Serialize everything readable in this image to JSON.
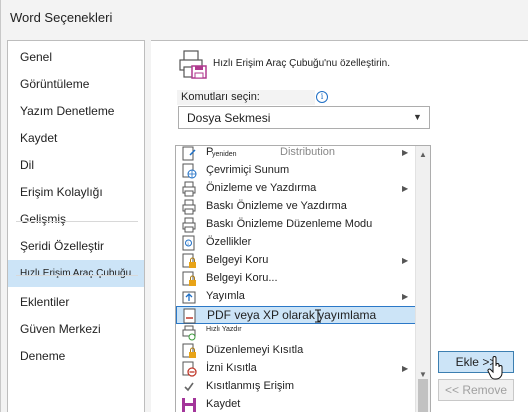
{
  "window": {
    "title": "Word Seçenekleri"
  },
  "sidebar": {
    "items": [
      {
        "label": "Genel"
      },
      {
        "label": "Görüntüleme"
      },
      {
        "label": "Yazım Denetleme"
      },
      {
        "label": "Kaydet"
      },
      {
        "label": "Dil"
      },
      {
        "label": "Erişim Kolaylığı"
      },
      {
        "label": "Gelişmiş"
      },
      {
        "label": "Şeridi Özelleştir"
      },
      {
        "label": "Hızlı Erişim Araç Çubuğu",
        "selected": true
      },
      {
        "label": "Eklentiler"
      },
      {
        "label": "Güven Merkezi"
      },
      {
        "label": "Deneme"
      }
    ]
  },
  "main": {
    "heading": "Hızlı Erişim Araç Çubuğu'nu özelleştirin.",
    "commands_label": "Komutları seçin:",
    "commands_dropdown": {
      "value": "Dosya Sekmesi"
    },
    "list": [
      {
        "label": "P",
        "small": "yeniden",
        "extra": "Distribution",
        "icon": "redistribute-icon",
        "submenu": true
      },
      {
        "label": "Çevrimiçi Sunum",
        "icon": "online-presentation-icon",
        "submenu": false
      },
      {
        "label": "Önizleme ve Yazdırma",
        "icon": "print-preview-icon",
        "submenu": true
      },
      {
        "label": "Baskı Önizleme ve Yazdırma",
        "icon": "print-preview-icon",
        "submenu": false
      },
      {
        "label": "Baskı Önizleme Düzenleme Modu",
        "icon": "print-preview-edit-icon",
        "submenu": false
      },
      {
        "label": "Özellikler",
        "icon": "properties-icon",
        "submenu": false
      },
      {
        "label": "Belgeyi Koru",
        "icon": "protect-document-icon",
        "submenu": true
      },
      {
        "label": "Belgeyi Koru...",
        "icon": "protect-document-icon",
        "submenu": false
      },
      {
        "label": "Yayımla",
        "icon": "publish-icon",
        "submenu": true
      },
      {
        "label": "PDF veya XP olarak yayımlama",
        "icon": "pdf-icon",
        "submenu": false,
        "selected": true
      },
      {
        "label": "Hızlı Yazdır",
        "icon": "quick-print-icon",
        "submenu": false,
        "small_only": true
      },
      {
        "label": "Düzenlemeyi Kısıtla",
        "icon": "restrict-editing-icon",
        "submenu": false
      },
      {
        "label": "İzni Kısıtla",
        "icon": "restrict-permission-icon",
        "submenu": true
      },
      {
        "label": "Kısıtlanmış Erişim",
        "icon": "check-icon",
        "submenu": false
      },
      {
        "label": "Kaydet",
        "icon": "save-icon",
        "submenu": false
      }
    ]
  },
  "buttons": {
    "add": "Ekle >>",
    "remove": "<< Remove"
  },
  "colors": {
    "selection": "#cce4f7",
    "selection_border": "#2b78c7",
    "accent": "#1f6fc5"
  }
}
